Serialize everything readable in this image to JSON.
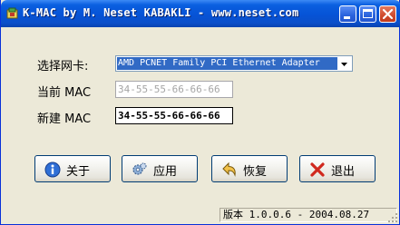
{
  "window": {
    "title": "K-MAC by M. Neset KABAKLI - www.neset.com"
  },
  "form": {
    "adapter_label": "选择网卡:",
    "adapter_selected": "AMD PCNET Family PCI Ethernet Adapter",
    "current_mac_label": "当前 MAC",
    "current_mac_value": "34-55-55-66-66-66",
    "new_mac_label": "新建 MAC",
    "new_mac_value": "34-55-55-66-66-66"
  },
  "buttons": {
    "about": "关于",
    "apply": "应用",
    "restore": "恢复",
    "exit": "退出"
  },
  "status": {
    "version": "版本 1.0.0.6 - 2004.08.27"
  },
  "colors": {
    "title_bar": "#0653d6",
    "selection": "#316ac5",
    "window_face": "#ece9d8"
  },
  "icons": [
    "app-icon",
    "minimize-icon",
    "maximize-icon",
    "close-icon",
    "info-icon",
    "gear-icon",
    "undo-arrow-icon",
    "x-icon",
    "chevron-down-icon",
    "resize-grip-icon"
  ]
}
